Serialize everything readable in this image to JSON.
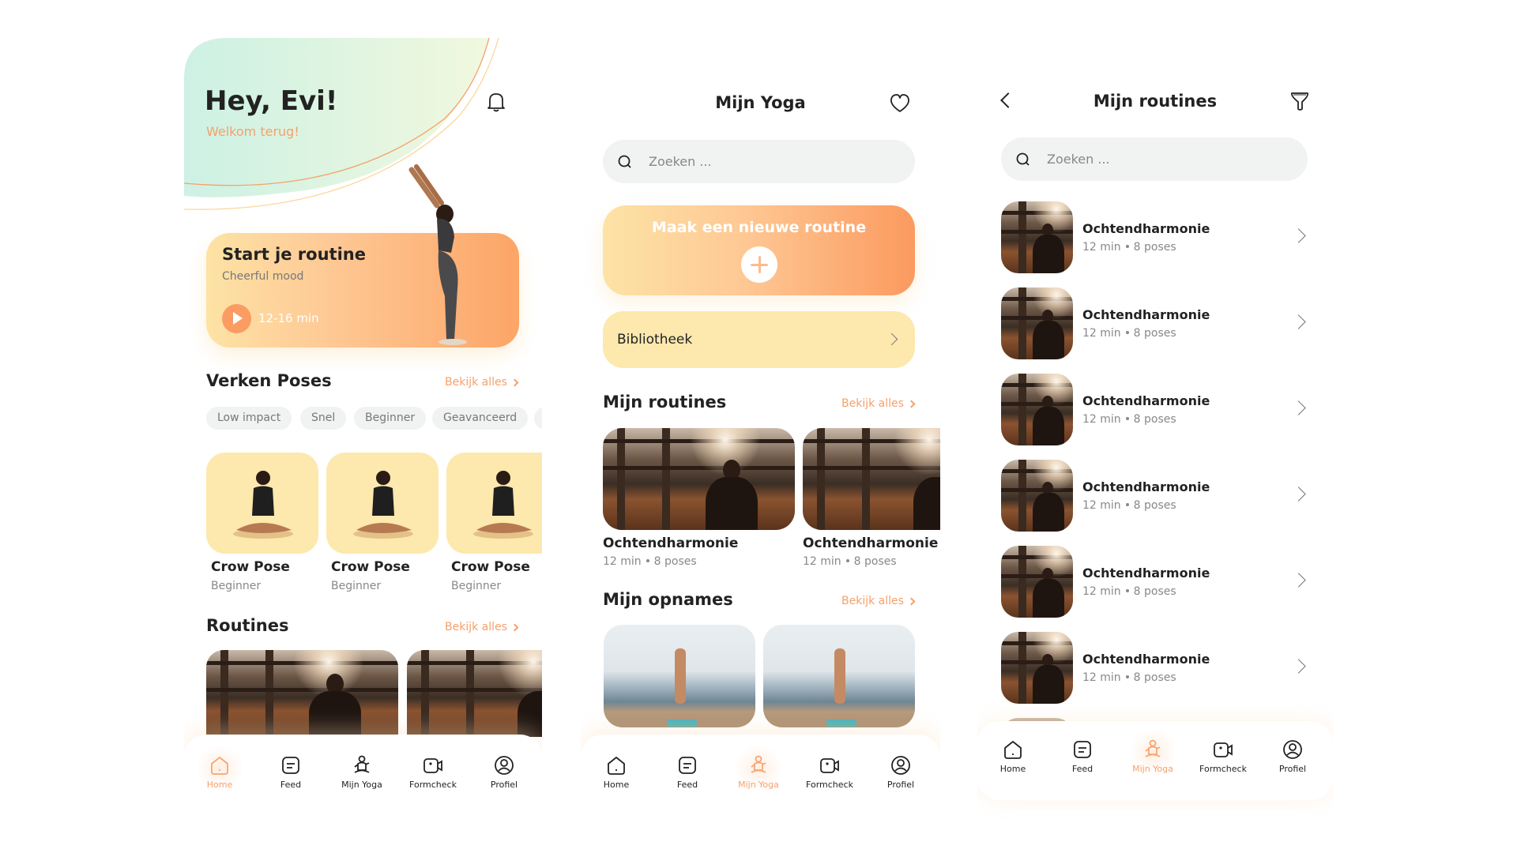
{
  "colors": {
    "accent": "#f6a06a",
    "card_yellow": "#fde8ad",
    "chip_bg": "#f1f2f2",
    "text": "#222222",
    "muted": "#888888"
  },
  "home": {
    "greeting": "Hey, Evi!",
    "subtitle": "Welkom terug!",
    "bell_icon": "bell-icon",
    "hero": {
      "title": "Start je routine",
      "mood": "Cheerful mood",
      "duration": "12-16 min",
      "play_icon": "play-icon"
    },
    "poses_section": {
      "title": "Verken Poses",
      "see_all": "Bekijk alles"
    },
    "chips": [
      "Low impact",
      "Snel",
      "Beginner",
      "Geavanceerd"
    ],
    "poses": [
      {
        "name": "Crow Pose",
        "level": "Beginner"
      },
      {
        "name": "Crow Pose",
        "level": "Beginner"
      },
      {
        "name": "Crow Pose",
        "level": "Beginner"
      }
    ],
    "routines_section": {
      "title": "Routines",
      "see_all": "Bekijk alles"
    }
  },
  "mijn_yoga": {
    "title": "Mijn Yoga",
    "heart_icon": "heart-icon",
    "search_placeholder": "Zoeken ...",
    "new_routine": "Maak een nieuwe routine",
    "library": "Bibliotheek",
    "routines_section": {
      "title": "Mijn routines",
      "see_all": "Bekijk alles"
    },
    "routines": [
      {
        "name": "Ochtendharmonie",
        "duration": "12 min",
        "poses": "8 poses"
      },
      {
        "name": "Ochtendharmonie",
        "duration": "12 min",
        "poses": "8 poses"
      }
    ],
    "recordings_section": {
      "title": "Mijn opnames",
      "see_all": "Bekijk alles"
    }
  },
  "mijn_routines": {
    "title": "Mijn routines",
    "search_placeholder": "Zoeken ...",
    "items": [
      {
        "name": "Ochtendharmonie",
        "duration": "12 min",
        "poses": "8 poses"
      },
      {
        "name": "Ochtendharmonie",
        "duration": "12 min",
        "poses": "8 poses"
      },
      {
        "name": "Ochtendharmonie",
        "duration": "12 min",
        "poses": "8 poses"
      },
      {
        "name": "Ochtendharmonie",
        "duration": "12 min",
        "poses": "8 poses"
      },
      {
        "name": "Ochtendharmonie",
        "duration": "12 min",
        "poses": "8 poses"
      },
      {
        "name": "Ochtendharmonie",
        "duration": "12 min",
        "poses": "8 poses"
      }
    ]
  },
  "nav": {
    "items": [
      {
        "label": "Home",
        "icon": "home-icon"
      },
      {
        "label": "Feed",
        "icon": "feed-icon"
      },
      {
        "label": "Mijn Yoga",
        "icon": "yoga-icon"
      },
      {
        "label": "Formcheck",
        "icon": "video-camera-icon"
      },
      {
        "label": "Profiel",
        "icon": "profile-icon"
      }
    ],
    "active_by_screen": [
      "Home",
      "Mijn Yoga",
      "Mijn Yoga"
    ]
  }
}
